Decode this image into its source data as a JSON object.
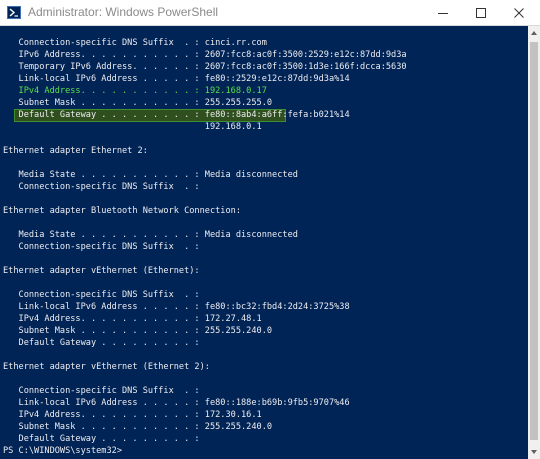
{
  "window": {
    "title": "Administrator: Windows PowerShell",
    "colors": {
      "background": "#012456",
      "text": "#eeedf0",
      "highlight_text": "#59e04a"
    }
  },
  "icons": {
    "app": "powershell-icon",
    "minimize": "minimize-icon",
    "maximize": "maximize-icon",
    "close": "close-icon"
  },
  "console": {
    "lines": [
      "   Connection-specific DNS Suffix  . : cinci.rr.com",
      "   IPv6 Address. . . . . . . . . . . : 2607:fcc8:ac0f:3500:2529:e12c:87dd:9d3a",
      "   Temporary IPv6 Address. . . . . . : 2607:fcc8:ac0f:3500:1d3e:166f:dcca:5630",
      "   Link-local IPv6 Address . . . . . : fe80::2529:e12c:87dd:9d3a%14",
      "   IPv4 Address. . . . . . . . . . . : 192.168.0.17",
      "   Subnet Mask . . . . . . . . . . . : 255.255.255.0",
      "   Default Gateway . . . . . . . . . : fe80::8ab4:a6ff:fefa:b021%14",
      "                                       192.168.0.1",
      "",
      "Ethernet adapter Ethernet 2:",
      "",
      "   Media State . . . . . . . . . . . : Media disconnected",
      "   Connection-specific DNS Suffix  . :",
      "",
      "Ethernet adapter Bluetooth Network Connection:",
      "",
      "   Media State . . . . . . . . . . . : Media disconnected",
      "   Connection-specific DNS Suffix  . :",
      "",
      "Ethernet adapter vEthernet (Ethernet):",
      "",
      "   Connection-specific DNS Suffix  . :",
      "   Link-local IPv6 Address . . . . . : fe80::bc32:fbd4:2d24:3725%38",
      "   IPv4 Address. . . . . . . . . . . : 172.27.48.1",
      "   Subnet Mask . . . . . . . . . . . : 255.255.240.0",
      "   Default Gateway . . . . . . . . . :",
      "",
      "Ethernet adapter vEthernet (Ethernet 2):",
      "",
      "   Connection-specific DNS Suffix  . :",
      "   Link-local IPv6 Address . . . . . : fe80::188e:b69b:9fb5:9707%46",
      "   IPv4 Address. . . . . . . . . . . : 172.30.16.1",
      "   Subnet Mask . . . . . . . . . . . : 255.255.240.0",
      "   Default Gateway . . . . . . . . . :",
      "PS C:\\WINDOWS\\system32>"
    ],
    "highlighted_line_index": 4
  }
}
